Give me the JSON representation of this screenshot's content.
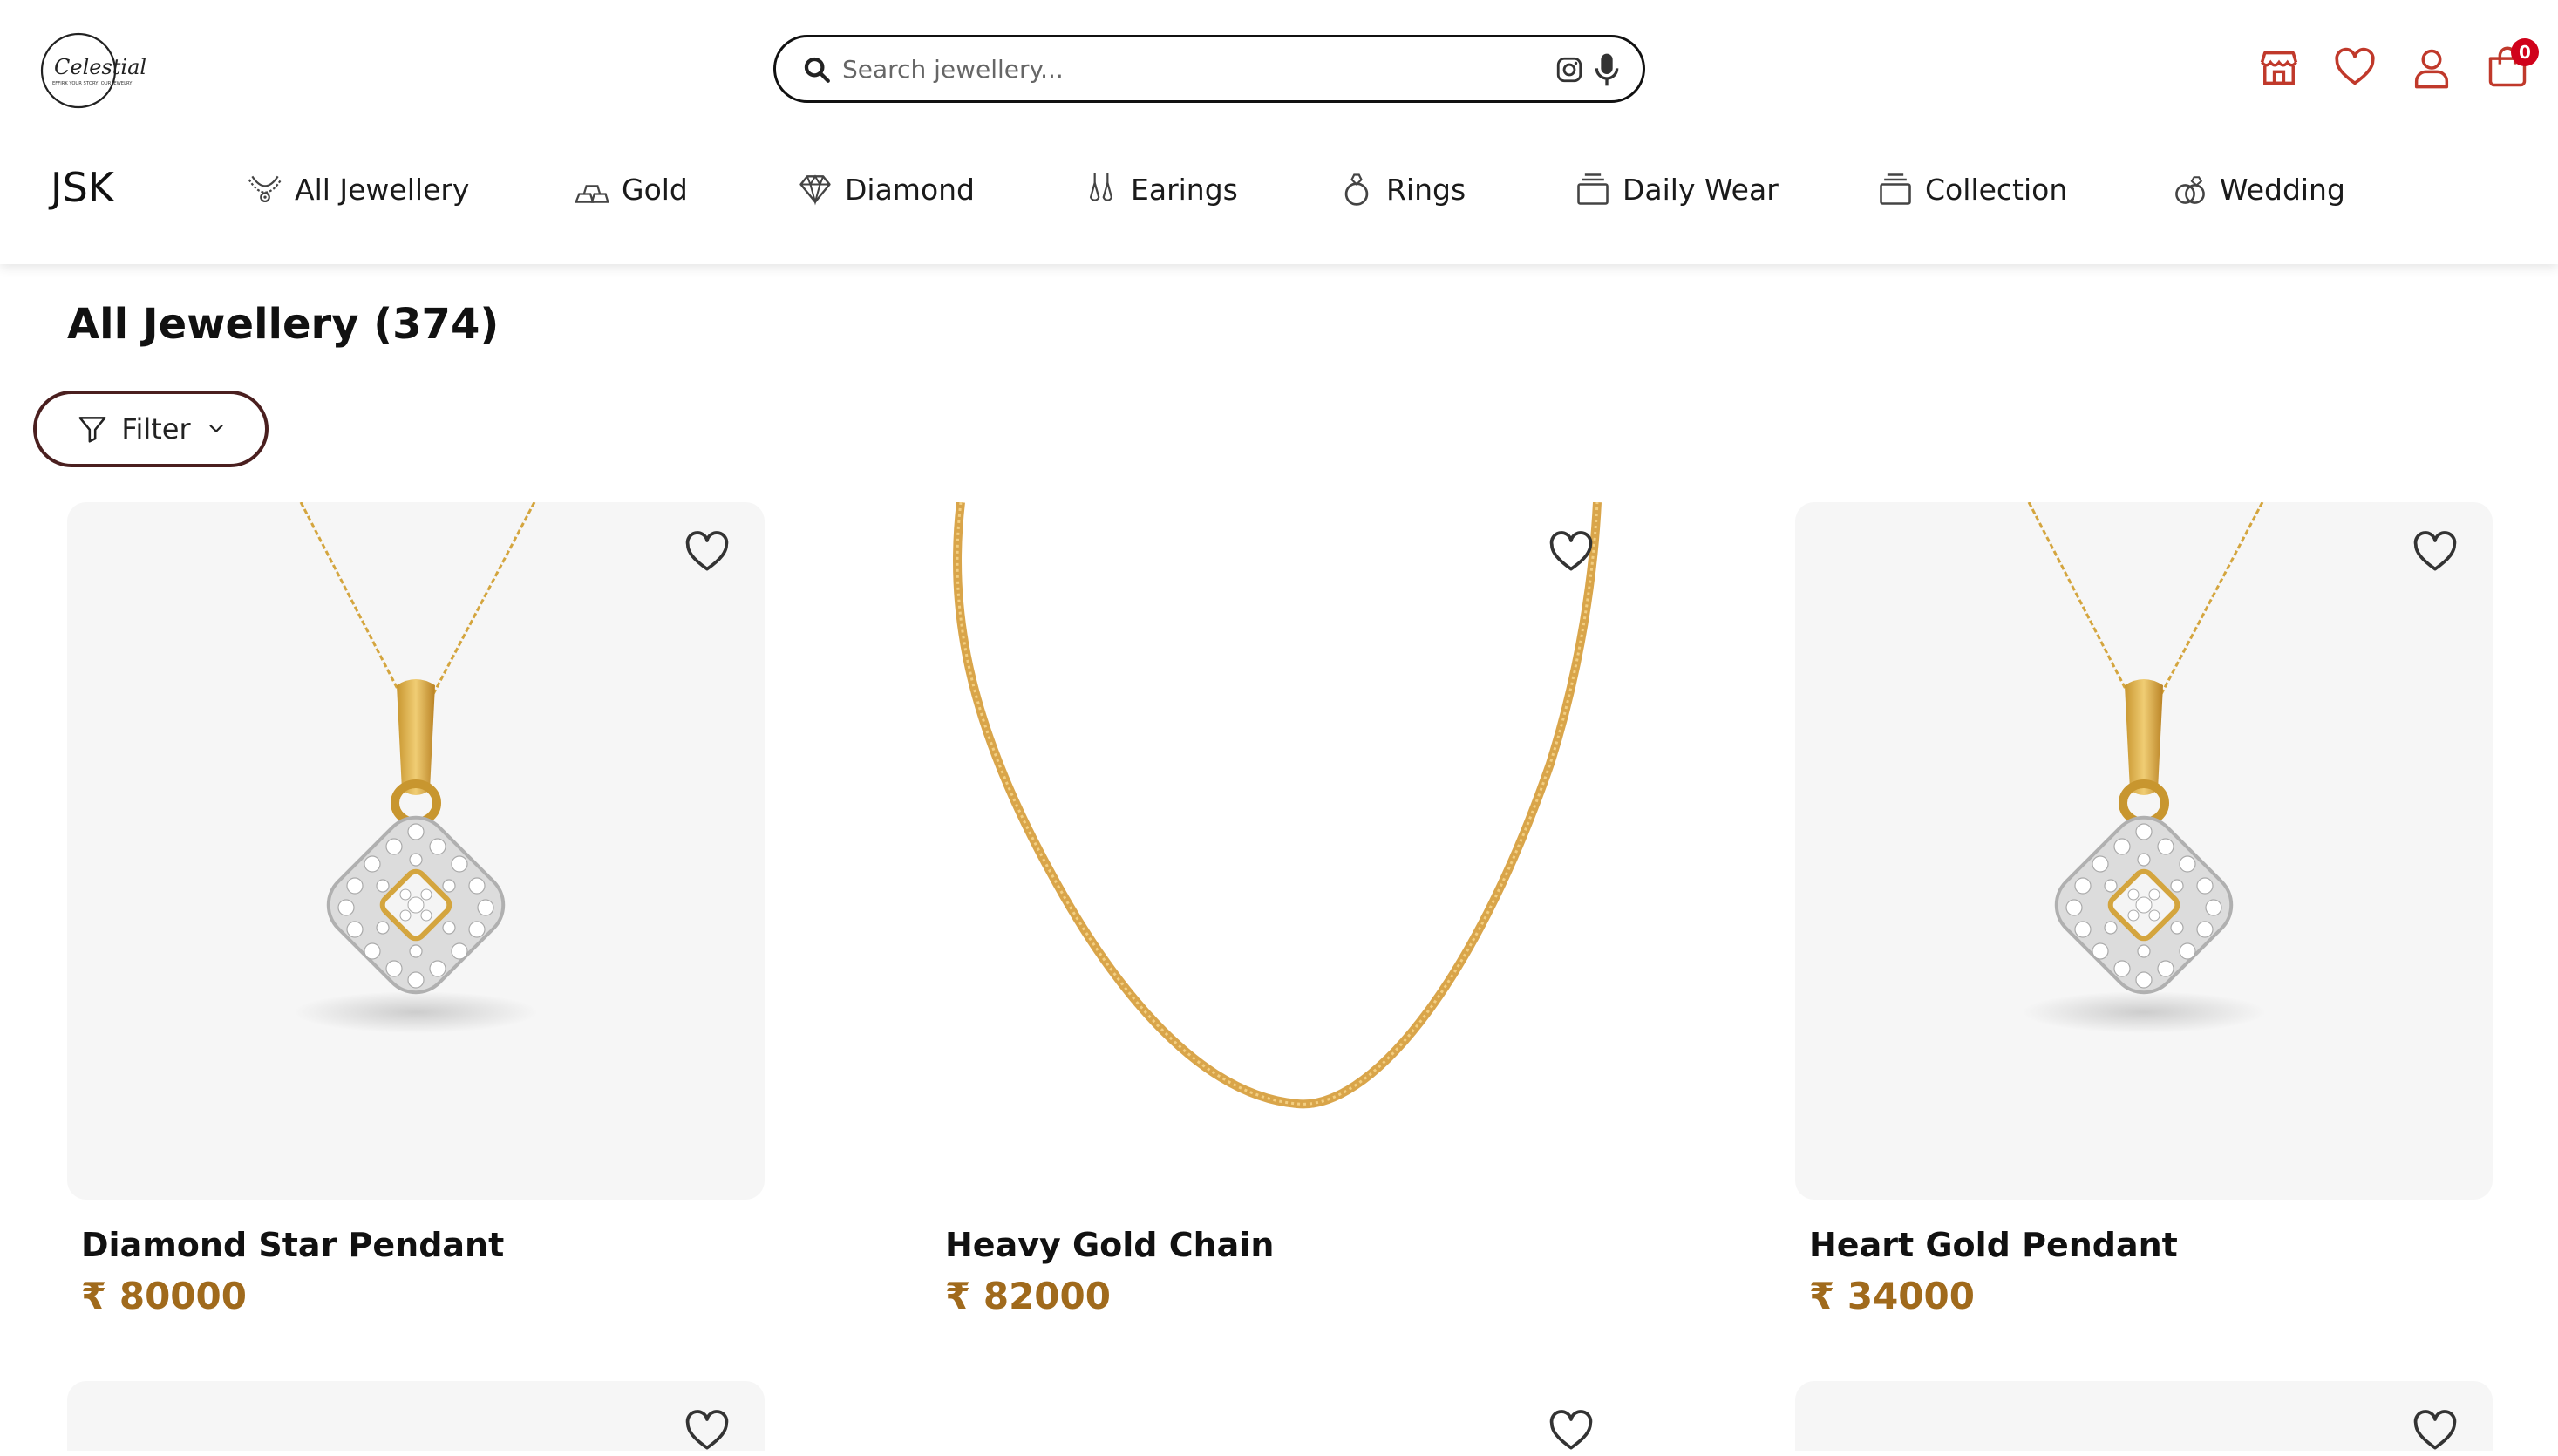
{
  "header": {
    "logo_text": "Celestial",
    "logo_tagline": "EFFIRK YOUR STORY, OUR JEWELRY",
    "search": {
      "placeholder": "Search jewellery...",
      "value": ""
    },
    "cart_count": "0"
  },
  "nav": {
    "brand": "JSK",
    "items": [
      {
        "label": "All Jewellery",
        "icon": "necklace-icon"
      },
      {
        "label": "Gold",
        "icon": "gold-bars-icon"
      },
      {
        "label": "Diamond",
        "icon": "diamond-icon"
      },
      {
        "label": "Earings",
        "icon": "earrings-icon"
      },
      {
        "label": "Rings",
        "icon": "ring-icon"
      },
      {
        "label": "Daily Wear",
        "icon": "stack-icon"
      },
      {
        "label": "Collection",
        "icon": "stack-icon"
      },
      {
        "label": "Wedding",
        "icon": "wedding-rings-icon"
      }
    ]
  },
  "main": {
    "title": "All Jewellery (374)",
    "filter_label": "Filter",
    "products": [
      {
        "name": "Diamond Star Pendant",
        "price": "₹ 80000",
        "image": "diamond-pendant"
      },
      {
        "name": "Heavy Gold Chain",
        "price": "₹ 82000",
        "image": "gold-chain"
      },
      {
        "name": "Heart Gold Pendant",
        "price": "₹ 34000",
        "image": "diamond-pendant"
      }
    ]
  },
  "colors": {
    "accent_price": "#a06a1c",
    "filter_border": "#4a1f1f",
    "badge": "#d0021b",
    "icon_red": "#c0392b",
    "card_bg": "#f6f6f6"
  }
}
